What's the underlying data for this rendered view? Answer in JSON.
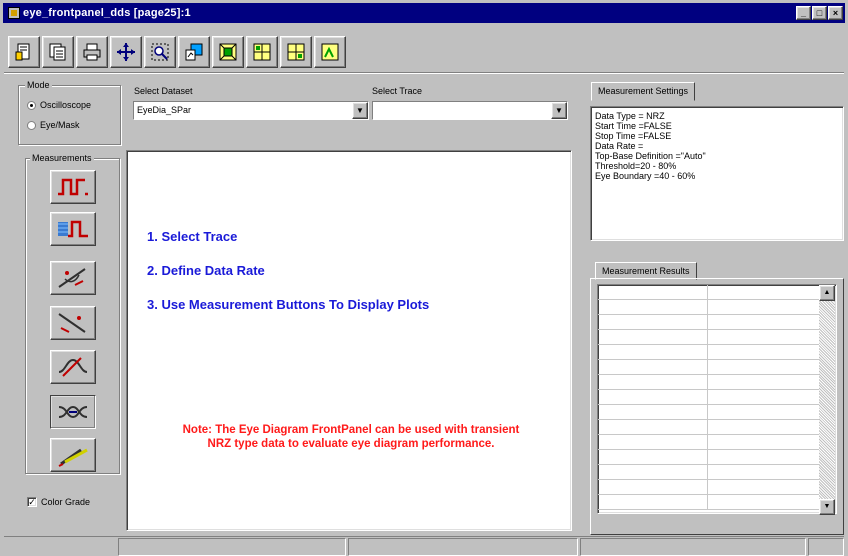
{
  "window": {
    "title": "eye_frontpanel_dds [page25]:1",
    "controls": [
      "minimize-icon",
      "maximize-icon",
      "close-icon"
    ]
  },
  "toolbar": {
    "icons": [
      "page-icon",
      "page-stack-icon",
      "print-icon",
      "move-arrows-icon",
      "zoom-box-icon",
      "copy-graph-icon",
      "grid-fit-icon",
      "plot-view-1-icon",
      "plot-view-2-icon",
      "plot-view-3-icon"
    ]
  },
  "mode": {
    "label": "Mode",
    "options": [
      "Oscilloscope",
      "Eye/Mask"
    ],
    "selected": "Oscilloscope"
  },
  "measurements": {
    "label": "Measurements",
    "buttons": [
      "pulse-measure-icon",
      "pulse-color-measure-icon",
      "rise-slope-icon",
      "fall-slope-icon",
      "cross-slope-icon",
      "eye-crossing-icon",
      "pencil-measure-icon"
    ]
  },
  "color_grade": {
    "label": "Color Grade",
    "checked": true
  },
  "dataset": {
    "label": "Select Dataset",
    "value": "EyeDia_SPar"
  },
  "trace": {
    "label": "Select Trace",
    "value": ""
  },
  "instructions": {
    "step1": "1. Select Trace",
    "step2": "2. Define Data Rate",
    "step3": "3. Use Measurement Buttons To Display Plots",
    "note_line1": "Note: The Eye Diagram FrontPanel can be used with transient",
    "note_line2": "NRZ type data to evaluate eye diagram performance."
  },
  "settings": {
    "tab_label": "Measurement Settings",
    "lines": [
      "Data Type = NRZ",
      "Start Time =FALSE",
      "Stop Time =FALSE",
      "Data Rate =",
      "Top-Base Definition =\"Auto\"",
      "Threshold=20 - 80%",
      "Eye Boundary =40 - 60%"
    ]
  },
  "results": {
    "tab_label": "Measurement Results"
  },
  "colors": {
    "title_bar": "#000080",
    "instruction_text": "#1a1ad8",
    "note_text": "#ff1a1a",
    "face": "#c0c0c0"
  }
}
